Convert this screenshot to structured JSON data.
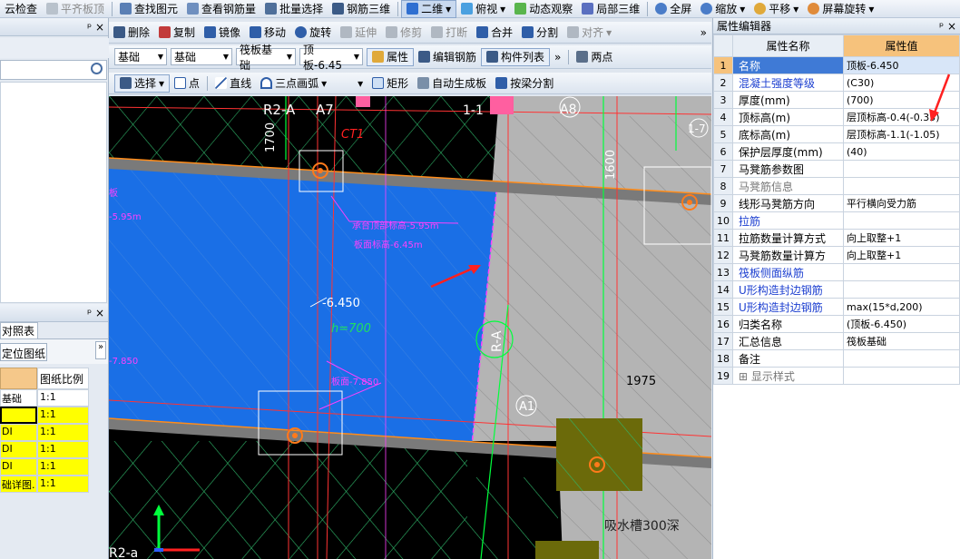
{
  "toolbar1": {
    "items": [
      {
        "label": "云检查",
        "disabled": false
      },
      {
        "label": "平齐板顶",
        "disabled": true
      },
      {
        "label": "查找图元",
        "disabled": false
      },
      {
        "label": "查看钢筋量",
        "disabled": false
      },
      {
        "label": "批量选择",
        "disabled": false
      },
      {
        "label": "钢筋三维",
        "disabled": false
      },
      {
        "label": "二维",
        "disabled": false
      },
      {
        "label": "俯视",
        "disabled": false
      },
      {
        "label": "动态观察",
        "disabled": false
      },
      {
        "label": "局部三维",
        "disabled": false
      },
      {
        "label": "全屏",
        "disabled": false
      },
      {
        "label": "缩放",
        "disabled": false
      },
      {
        "label": "平移",
        "disabled": false
      },
      {
        "label": "屏幕旋转",
        "disabled": false
      }
    ]
  },
  "toolbar2": {
    "items": [
      {
        "label": "删除",
        "disabled": false
      },
      {
        "label": "复制",
        "disabled": false
      },
      {
        "label": "镜像",
        "disabled": false
      },
      {
        "label": "移动",
        "disabled": false
      },
      {
        "label": "旋转",
        "disabled": false
      },
      {
        "label": "延伸",
        "disabled": true
      },
      {
        "label": "修剪",
        "disabled": true
      },
      {
        "label": "打断",
        "disabled": true
      },
      {
        "label": "合并",
        "disabled": false
      },
      {
        "label": "分割",
        "disabled": false
      },
      {
        "label": "对齐",
        "disabled": true
      }
    ],
    "overflow": "»"
  },
  "toolbar3": {
    "combos": [
      "基础",
      "基础",
      "筏板基础",
      "顶板-6.45"
    ],
    "buttons": [
      "属性",
      "编辑钢筋",
      "构件列表"
    ],
    "extra": "两点"
  },
  "toolbar4": {
    "buttons": [
      "选择",
      "点",
      "直线",
      "三点画弧",
      "矩形",
      "自动生成板",
      "按梁分割"
    ]
  },
  "left_panel": {
    "top_icons": "ᵖ ×",
    "search_icon": "search-icon",
    "lower_title_icons": "ᵖ ×",
    "tab_label": "对照表",
    "locate_button": "定位图纸",
    "column_header": "图纸比例",
    "rows": [
      {
        "name": "基础",
        "ratio": "1:1",
        "highlight": false
      },
      {
        "name": "",
        "ratio": "1:1",
        "highlight": true
      },
      {
        "name": "DI",
        "ratio": "1:1",
        "highlight": true
      },
      {
        "name": "DI",
        "ratio": "1:1",
        "highlight": true
      },
      {
        "name": "DI",
        "ratio": "1:1",
        "highlight": true
      },
      {
        "name": "础详图.",
        "ratio": "1:1",
        "highlight": true
      }
    ]
  },
  "canvas": {
    "labels": {
      "r2a_top": "R2-A",
      "a7": "A7",
      "ct1": "CT1",
      "a8": "A8",
      "one_one": "1-1",
      "dim_1700": "1700",
      "dim_1600": "1600",
      "anno1": "承台顶部标高-5.95m",
      "anno2": "板面标高-6.45m",
      "elev": "-6.450",
      "h700": "h=700",
      "rot_ra": "R-A",
      "a1": "A1",
      "dim_1975": "1975",
      "bottom_anno": "板面-7.850",
      "left_cut1": "-5.95m",
      "left_cut2": "-7.850",
      "left_cut3": "板",
      "water": "吸水槽300深",
      "r2a_bottom": "R2-a",
      "one_seven": "1-7"
    }
  },
  "property_editor": {
    "title": "属性编辑器",
    "title_icons": "ᵖ ×",
    "col_name": "属性名称",
    "col_value": "属性值",
    "rows": [
      {
        "n": "1",
        "name": "名称",
        "value": "顶板-6.450",
        "blue": true
      },
      {
        "n": "2",
        "name": "混凝土强度等级",
        "value": "(C30)",
        "blue": true
      },
      {
        "n": "3",
        "name": "厚度(mm)",
        "value": "(700)",
        "blue": false
      },
      {
        "n": "4",
        "name": "顶标高(m)",
        "value": "层顶标高-0.4(-0.35)",
        "blue": false
      },
      {
        "n": "5",
        "name": "底标高(m)",
        "value": "层顶标高-1.1(-1.05)",
        "blue": false
      },
      {
        "n": "6",
        "name": "保护层厚度(mm)",
        "value": "(40)",
        "blue": false
      },
      {
        "n": "7",
        "name": "马凳筋参数图",
        "value": "",
        "blue": false
      },
      {
        "n": "8",
        "name": "马凳筋信息",
        "value": "",
        "blue": false,
        "gray": true
      },
      {
        "n": "9",
        "name": "线形马凳筋方向",
        "value": "平行横向受力筋",
        "blue": false
      },
      {
        "n": "10",
        "name": "拉筋",
        "value": "",
        "blue": true
      },
      {
        "n": "11",
        "name": "拉筋数量计算方式",
        "value": "向上取整+1",
        "blue": false
      },
      {
        "n": "12",
        "name": "马凳筋数量计算方",
        "value": "向上取整+1",
        "blue": false
      },
      {
        "n": "13",
        "name": "筏板侧面纵筋",
        "value": "",
        "blue": true
      },
      {
        "n": "14",
        "name": "U形构造封边钢筋",
        "value": "",
        "blue": true
      },
      {
        "n": "15",
        "name": "U形构造封边钢筋",
        "value": "max(15*d,200)",
        "blue": true
      },
      {
        "n": "16",
        "name": "归类名称",
        "value": "(顶板-6.450)",
        "blue": false
      },
      {
        "n": "17",
        "name": "汇总信息",
        "value": "筏板基础",
        "blue": false
      },
      {
        "n": "18",
        "name": "备注",
        "value": "",
        "blue": false
      },
      {
        "n": "19",
        "name": "⊞ 显示样式",
        "value": "",
        "blue": false,
        "gray": true
      }
    ]
  }
}
